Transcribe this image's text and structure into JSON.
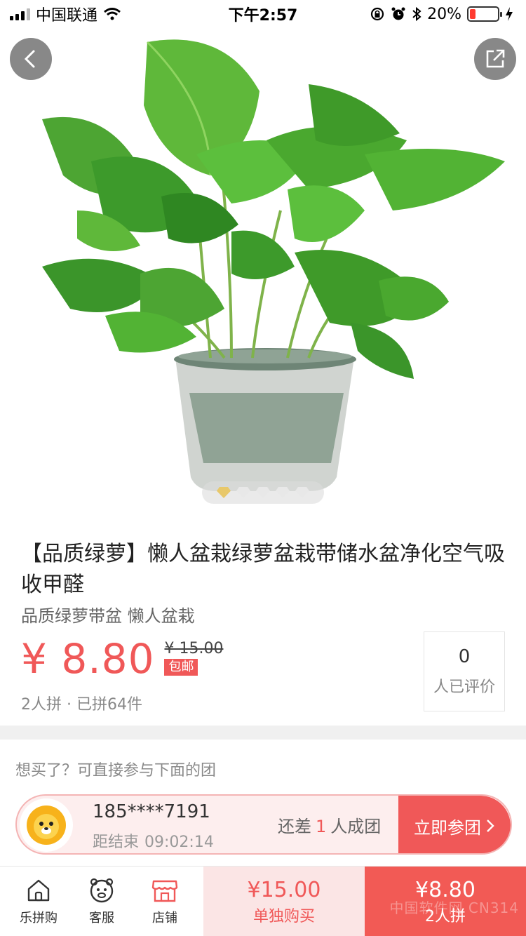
{
  "status_bar": {
    "carrier": "中国联通",
    "time": "下午2:57",
    "battery": "20%",
    "battery_level": 0.2
  },
  "gallery": {
    "image_count": 5,
    "active_index": 0
  },
  "product": {
    "title": "【品质绿萝】懒人盆栽绿萝盆栽带储水盆净化空气吸收甲醛",
    "subtitle": "品质绿萝带盆  懒人盆栽",
    "price": "¥ 8.80",
    "original_price": "¥ 15.00",
    "shipping_tag": "包邮",
    "group_info": "2人拼 · 已拼64件",
    "review_count": "0",
    "review_label": "人已评价"
  },
  "join": {
    "hint": "想买了？可直接参与下面的团",
    "user": "185****7191",
    "timer_label": "距结束",
    "timer": "09:02:14",
    "status_prefix": "还差",
    "status_num": "1",
    "status_suffix": "人成团",
    "button": "立即参团"
  },
  "bottom_bar": {
    "tabs": [
      {
        "label": "乐拼购",
        "icon": "home-icon"
      },
      {
        "label": "客服",
        "icon": "customer-service-icon"
      },
      {
        "label": "店铺",
        "icon": "store-icon"
      }
    ],
    "buy_alone": {
      "price": "¥15.00",
      "label": "单独购买"
    },
    "buy_group": {
      "price": "¥8.80",
      "label": "2人拼"
    }
  },
  "colors": {
    "accent": "#f05858",
    "accent_light": "#fbe5e5",
    "divider": "#f0f0f0"
  },
  "watermark": "中国软件网 CN314"
}
